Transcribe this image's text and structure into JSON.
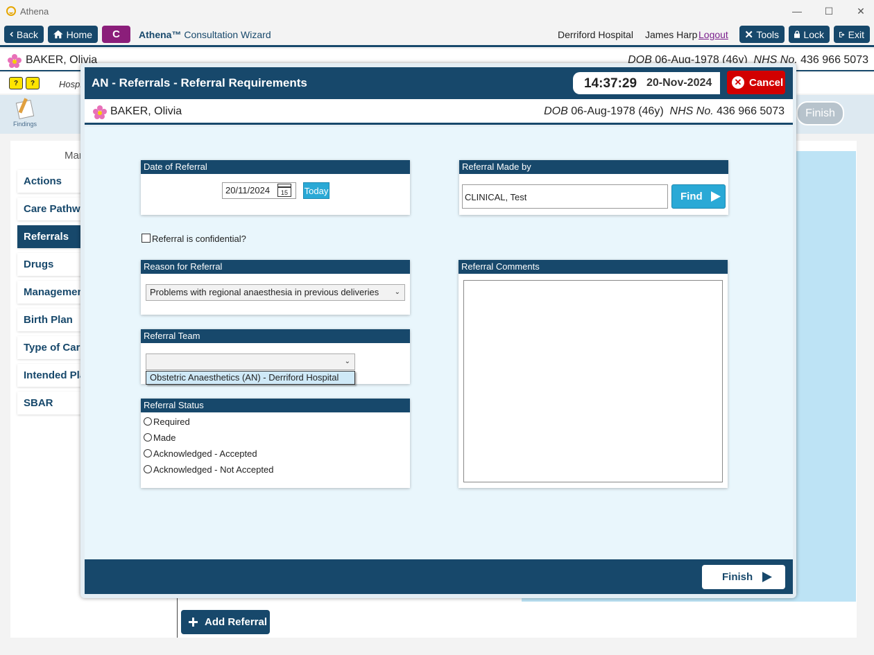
{
  "window": {
    "title": "Athena",
    "minimize": "—",
    "maximize": "☐",
    "close": "✕"
  },
  "toolbar": {
    "back_label": "Back",
    "home_label": "Home",
    "c_label": "C",
    "wizard_brand": "Athena™",
    "wizard_label": "Consultation Wizard",
    "hospital": "Derriford Hospital",
    "user": "James Harp",
    "logout_label": "Logout",
    "tools_label": "Tools",
    "lock_label": "Lock",
    "exit_label": "Exit"
  },
  "patient": {
    "name": "BAKER, Olivia",
    "dob_label": "DOB",
    "dob_value": "06-Aug-1978 (46y)",
    "nhs_label": "NHS No.",
    "nhs_value": "436 966 5073"
  },
  "background": {
    "hospital_partial": "Hospi",
    "findings_label": "Findings",
    "finish_label": "Finish",
    "sidebar_heading": "Mar",
    "sidebar_items": [
      "Actions",
      "Care Pathwa",
      "Referrals",
      "Drugs",
      "Managemen",
      "Birth Plan",
      "Type of Care",
      "Intended Pla",
      "SBAR"
    ],
    "add_referral_label": "Add Referral"
  },
  "dialog": {
    "title": "AN - Referrals - Referral Requirements",
    "time": "14:37:29",
    "date": "20-Nov-2024",
    "cancel_label": "Cancel",
    "date_of_referral": {
      "header": "Date of Referral",
      "value": "20/11/2024",
      "calendar_day": "15",
      "today_label": "Today"
    },
    "referral_made_by": {
      "header": "Referral Made by",
      "value": "CLINICAL, Test",
      "find_label": "Find"
    },
    "confidential_label": "Referral is confidential?",
    "reason": {
      "header": "Reason for Referral",
      "selected": "Problems with regional anaesthesia in previous deliveries"
    },
    "team": {
      "header": "Referral Team",
      "selected": "",
      "dropdown_option": "Obstetric Anaesthetics (AN) - Derriford Hospital"
    },
    "status": {
      "header": "Referral Status",
      "options": [
        "Required",
        "Made",
        "Acknowledged - Accepted",
        "Acknowledged - Not Accepted"
      ]
    },
    "comments": {
      "header": "Referral Comments",
      "value": ""
    },
    "finish_label": "Finish"
  },
  "colors": {
    "navy": "#17486b",
    "cancel_red": "#d20000",
    "accent_blue": "#2aa9d6",
    "c_purple": "#8b1e7a"
  }
}
